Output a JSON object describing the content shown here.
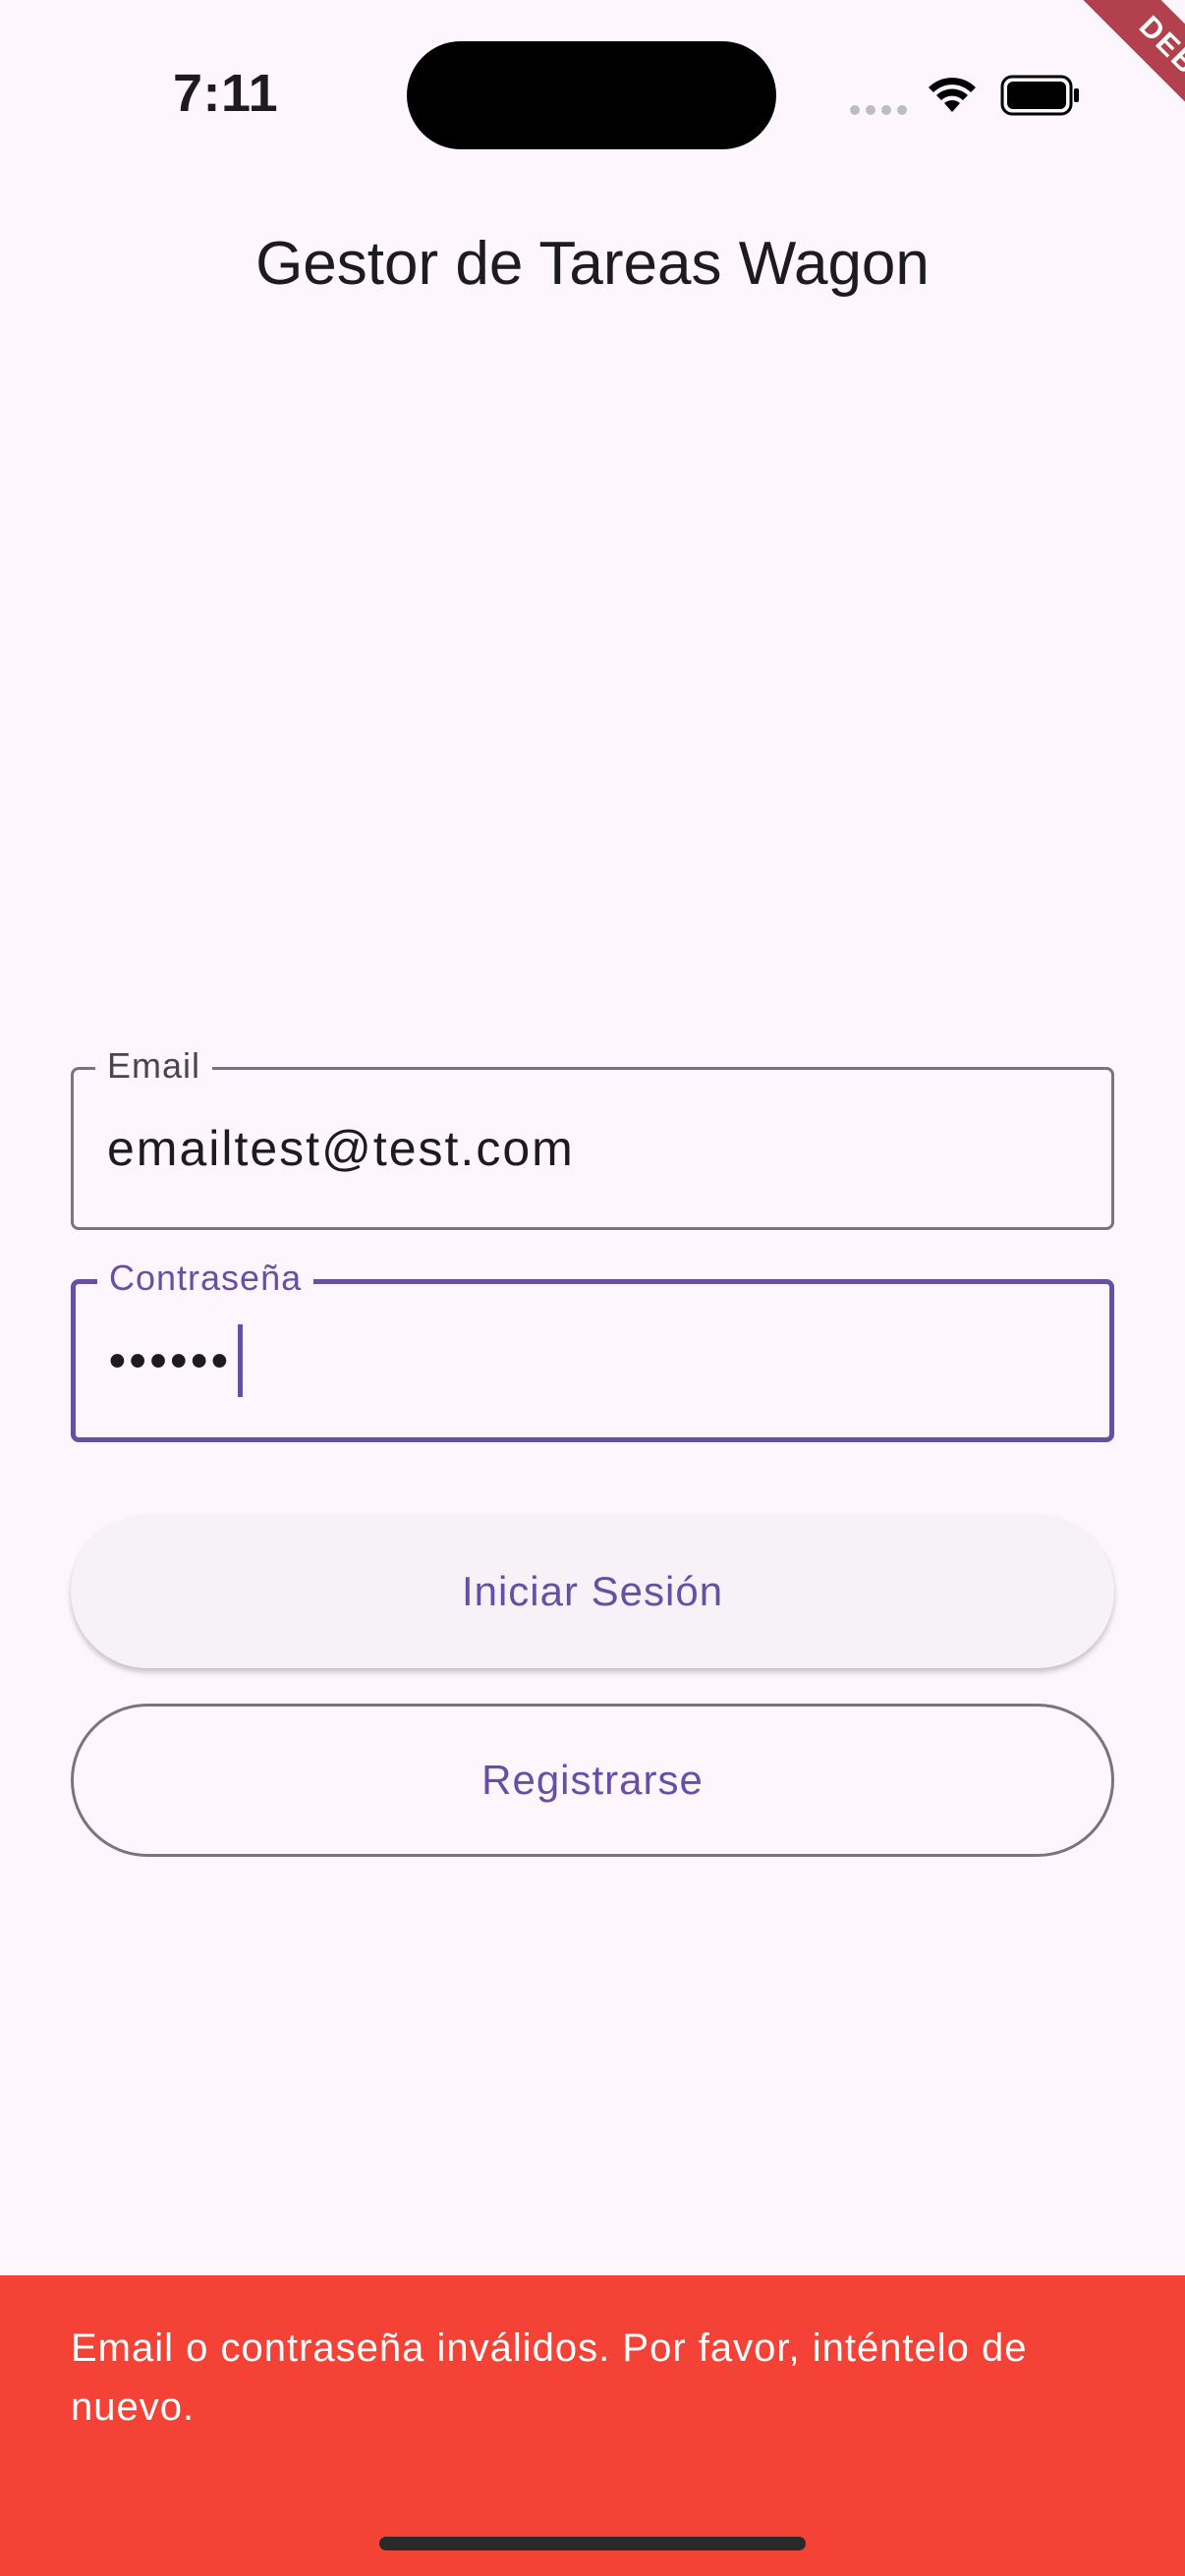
{
  "status_bar": {
    "time": "7:11"
  },
  "debug_banner": {
    "label": "DEBUG"
  },
  "app": {
    "title": "Gestor de Tareas Wagon"
  },
  "form": {
    "email": {
      "label": "Email",
      "value": "emailtest@test.com"
    },
    "password": {
      "label": "Contraseña",
      "value": "••••••"
    },
    "login_button": "Iniciar Sesión",
    "register_button": "Registrarse"
  },
  "snackbar": {
    "message": "Email o contraseña inválidos. Por favor, inténtelo de nuevo."
  },
  "colors": {
    "background": "#fdf7fd",
    "primary": "#6750a4",
    "outline": "#79747e",
    "error_snackbar": "#f44336",
    "debug_banner": "#b3414d"
  },
  "icons": [
    "signal-icon",
    "wifi-icon",
    "battery-icon"
  ]
}
